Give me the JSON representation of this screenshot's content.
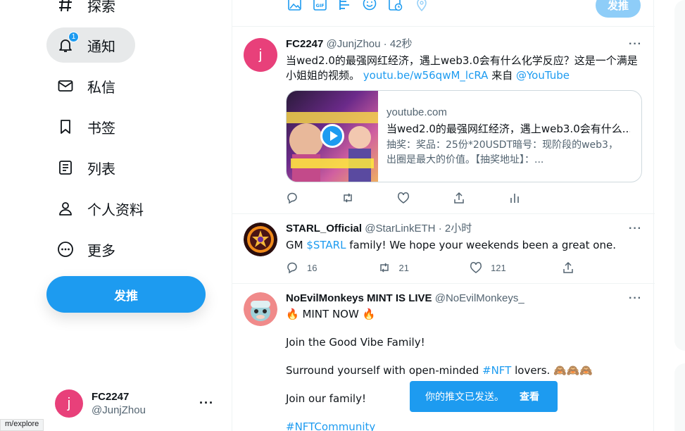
{
  "sidebar": {
    "items": [
      {
        "label": "探索",
        "icon": "hashtag-icon"
      },
      {
        "label": "通知",
        "icon": "bell-icon",
        "badge": "1"
      },
      {
        "label": "私信",
        "icon": "mail-icon"
      },
      {
        "label": "书签",
        "icon": "bookmark-icon"
      },
      {
        "label": "列表",
        "icon": "list-icon"
      },
      {
        "label": "个人资料",
        "icon": "person-icon"
      },
      {
        "label": "更多",
        "icon": "more-circle-icon"
      }
    ],
    "tweet_button": "发推",
    "account": {
      "avatar_letter": "j",
      "name": "FC2247",
      "handle": "@JunjZhou",
      "more": "···"
    },
    "status_url": "m/explore"
  },
  "compose": {
    "send_label": "发推"
  },
  "tweets": [
    {
      "name": "FC2247",
      "handle": "@JunjZhou",
      "time": "· 42秒",
      "avatar_letter": "j",
      "text_line1": "当wed2.0的最强网红经济，遇上web3.0会有什么化学反应？这是一个满是",
      "text_line2": "小姐姐的视频。",
      "link": "youtu.be/w56qwM_lcRA",
      "via": "来自",
      "via_link": "@YouTube",
      "card": {
        "domain": "youtube.com",
        "title": "当wed2.0的最强网红经济，遇上web3.0会有什么...",
        "desc_line1": "抽奖：奖品：25份*20USDT暗号：现阶段的web3，",
        "desc_line2": "出圈是最大的价值。【抽奖地址】：..."
      }
    },
    {
      "name": "STARL_Official",
      "handle": "@StarLinkETH",
      "time": "· 2小时",
      "text_pre": "GM ",
      "text_link": "$STARL",
      "text_post": " family! We hope your weekends been a great one.",
      "replies": "16",
      "retweets": "21",
      "likes": "121"
    },
    {
      "name": "NoEvilMonkeys MINT IS LIVE",
      "handle": "@NoEvilMonkeys_",
      "line1": "🔥 MINT NOW 🔥",
      "line2": "Join the Good Vibe Family!",
      "line3_pre": "Surround yourself with open-minded ",
      "line3_link": "#NFT",
      "line3_post": " lovers. 🙈🙈🙈",
      "line4": "Join our family!",
      "line5_link": "#NFTCommunity"
    }
  ],
  "toast": {
    "message": "你的推文已发送。",
    "action": "查看"
  },
  "colors": {
    "accent": "#1d9bf0",
    "text": "#0f1419",
    "muted": "#536471"
  }
}
